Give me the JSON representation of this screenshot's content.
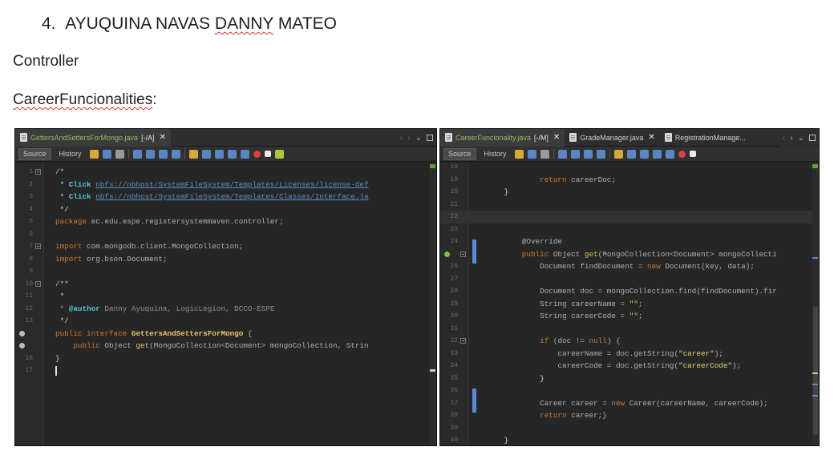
{
  "doc": {
    "heading_number": "4.",
    "heading_name_a": "AYUQUINA NAVAS",
    "heading_name_b": "DANNY",
    "heading_name_c": "MATEO",
    "section": "Controller",
    "subsection": "CareerFuncionalities",
    "subsection_suffix": ":"
  },
  "left": {
    "tab_name": "GettersAndSettersForMongo.java",
    "tab_suffix": "[-/A]",
    "toolbar": {
      "source": "Source",
      "history": "History"
    },
    "lines": [
      "1",
      "2",
      "3",
      "4",
      "5",
      "6",
      "7",
      "8",
      "9",
      "10",
      "11",
      "12",
      "13",
      "14",
      "15",
      "16",
      "17"
    ],
    "code": {
      "l1": "/*",
      "l2_pre": " * Click ",
      "l2_link": "nbfs://nbhost/SystemFileSystem/Templates/Licenses/license-def",
      "l3_pre": " * Click ",
      "l3_link": "nbfs://nbhost/SystemFileSystem/Templates/Classes/Interface.ja",
      "l4": " */",
      "l5_kw": "package",
      "l5_rest": " ec.edu.espe.registersystemmaven.controller;",
      "l7_kw": "import",
      "l7_rest": " com.mongodb.client.MongoCollection;",
      "l8_kw": "import",
      "l8_rest": " org.bson.Document;",
      "l10": "/**",
      "l11": " *",
      "l12_pre": " * ",
      "l12_tag": "@author",
      "l12_rest": " Danny Ayuquina, LogicLegion, DCCO-ESPE",
      "l13": " */",
      "l14_kw": "public interface",
      "l14_name": "GettersAndSettersForMongo",
      "l14_rest": " {",
      "l15_kw": "public",
      "l15_a": " Object ",
      "l15_m": "get",
      "l15_rest": "(MongoCollection<Document> mongoCollection, Strin",
      "l16": "}"
    }
  },
  "right": {
    "tabs": [
      {
        "name": "CareerFuncionality.java",
        "suffix": "[-/M]"
      },
      {
        "name": "GradeManager.java"
      },
      {
        "name": "RegistrationManage..."
      }
    ],
    "toolbar": {
      "source": "Source",
      "history": "History"
    },
    "lines": [
      "18",
      "19",
      "20",
      "21",
      "22",
      "23",
      "24",
      "25",
      "26",
      "27",
      "28",
      "29",
      "30",
      "31",
      "32",
      "33",
      "34",
      "35",
      "36",
      "37",
      "38",
      "39",
      "40",
      "41"
    ],
    "code": {
      "l19_kw": "return",
      "l19_rest": " careerDoc;",
      "l20": "}",
      "l24": "@Override",
      "l25_kw": "public",
      "l25_a": " Object ",
      "l25_m": "get",
      "l25_rest": "(MongoCollection<Document> mongoCollecti",
      "l26_a": "Document findDocument = ",
      "l26_kw": "new",
      "l26_rest": " Document(key, data);",
      "l28": "Document doc = mongoCollection.find(findDocument).fir",
      "l29_a": "String careerName = ",
      "l29_s": "\"\"",
      "l29_rest": ";",
      "l30_a": "String careerCode = ",
      "l30_s": "\"\"",
      "l30_rest": ";",
      "l32_kw": "if",
      "l32_a": " (doc != ",
      "l32_kw2": "null",
      "l32_rest": ") {",
      "l33_a": "careerName = doc.getString(",
      "l33_s": "\"career\"",
      "l33_rest": ");",
      "l34_a": "careerCode = doc.getString(",
      "l34_s": "\"careerCode\"",
      "l34_rest": ");",
      "l35": "}",
      "l37_a": "Career career = ",
      "l37_kw": "new",
      "l37_rest": " Career(careerName, careerCode);",
      "l38_kw": "return",
      "l38_rest": " career;",
      "l38_close": "}",
      "l40": "}"
    }
  }
}
